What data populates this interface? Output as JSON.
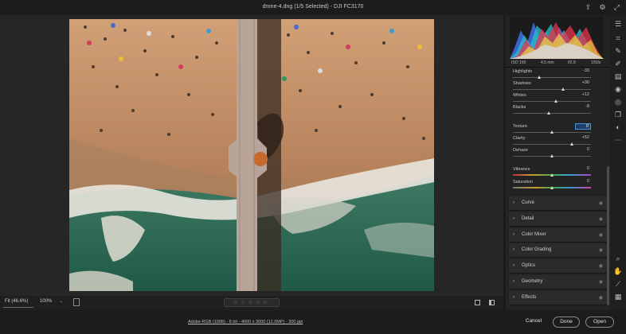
{
  "window": {
    "title": "drone-4.dng (1/5 Selected)  -  DJI FC3170"
  },
  "titlebar_icons": [
    "export-icon",
    "gear-icon",
    "expand-icon"
  ],
  "histogram": {
    "exif": {
      "iso": "ISO 100",
      "focal": "4.5 mm",
      "aperture": "f/2.8",
      "shutter": "1/50s"
    }
  },
  "sliders": [
    {
      "id": "highlights",
      "label": "Highlights",
      "value": "-33",
      "fraction": 0.34,
      "track": "plain"
    },
    {
      "id": "shadows",
      "label": "Shadows",
      "value": "+30",
      "fraction": 0.65,
      "track": "plain"
    },
    {
      "id": "whites",
      "label": "Whites",
      "value": "+12",
      "fraction": 0.56,
      "track": "plain"
    },
    {
      "id": "blacks",
      "label": "Blacks",
      "value": "-8",
      "fraction": 0.46,
      "track": "plain"
    },
    {
      "id": "texture",
      "label": "Texture",
      "value": "0",
      "fraction": 0.5,
      "track": "plain",
      "active": true
    },
    {
      "id": "clarity",
      "label": "Clarity",
      "value": "+52",
      "fraction": 0.76,
      "track": "plain"
    },
    {
      "id": "dehaze",
      "label": "Dehaze",
      "value": "0",
      "fraction": 0.5,
      "track": "plain"
    },
    {
      "id": "vibrance",
      "label": "Vibrance",
      "value": "0",
      "fraction": 0.5,
      "track": "vibrance"
    },
    {
      "id": "saturation",
      "label": "Saturation",
      "value": "0",
      "fraction": 0.5,
      "track": "saturation"
    }
  ],
  "sections": [
    {
      "id": "curve",
      "label": "Curve"
    },
    {
      "id": "detail",
      "label": "Detail"
    },
    {
      "id": "color-mixer",
      "label": "Color Mixer"
    },
    {
      "id": "color-grading",
      "label": "Color Grading"
    },
    {
      "id": "optics",
      "label": "Optics"
    },
    {
      "id": "geometry",
      "label": "Geometry"
    },
    {
      "id": "effects",
      "label": "Effects"
    }
  ],
  "bottom_toolbar": {
    "fit": "Fit (46.6%)",
    "zoom": "100%",
    "stars": "☆☆☆☆☆"
  },
  "footer": {
    "file_info": "Adobe RGB (1998) - 8 bit - 4000 x 3000 (12.0MP) - 300 ppi",
    "cancel": "Cancel",
    "done": "Done",
    "open": "Open"
  },
  "colors": {
    "accent": "#4a8fd8",
    "panel_bg": "#232323",
    "section_bg": "#2b2b2b"
  }
}
